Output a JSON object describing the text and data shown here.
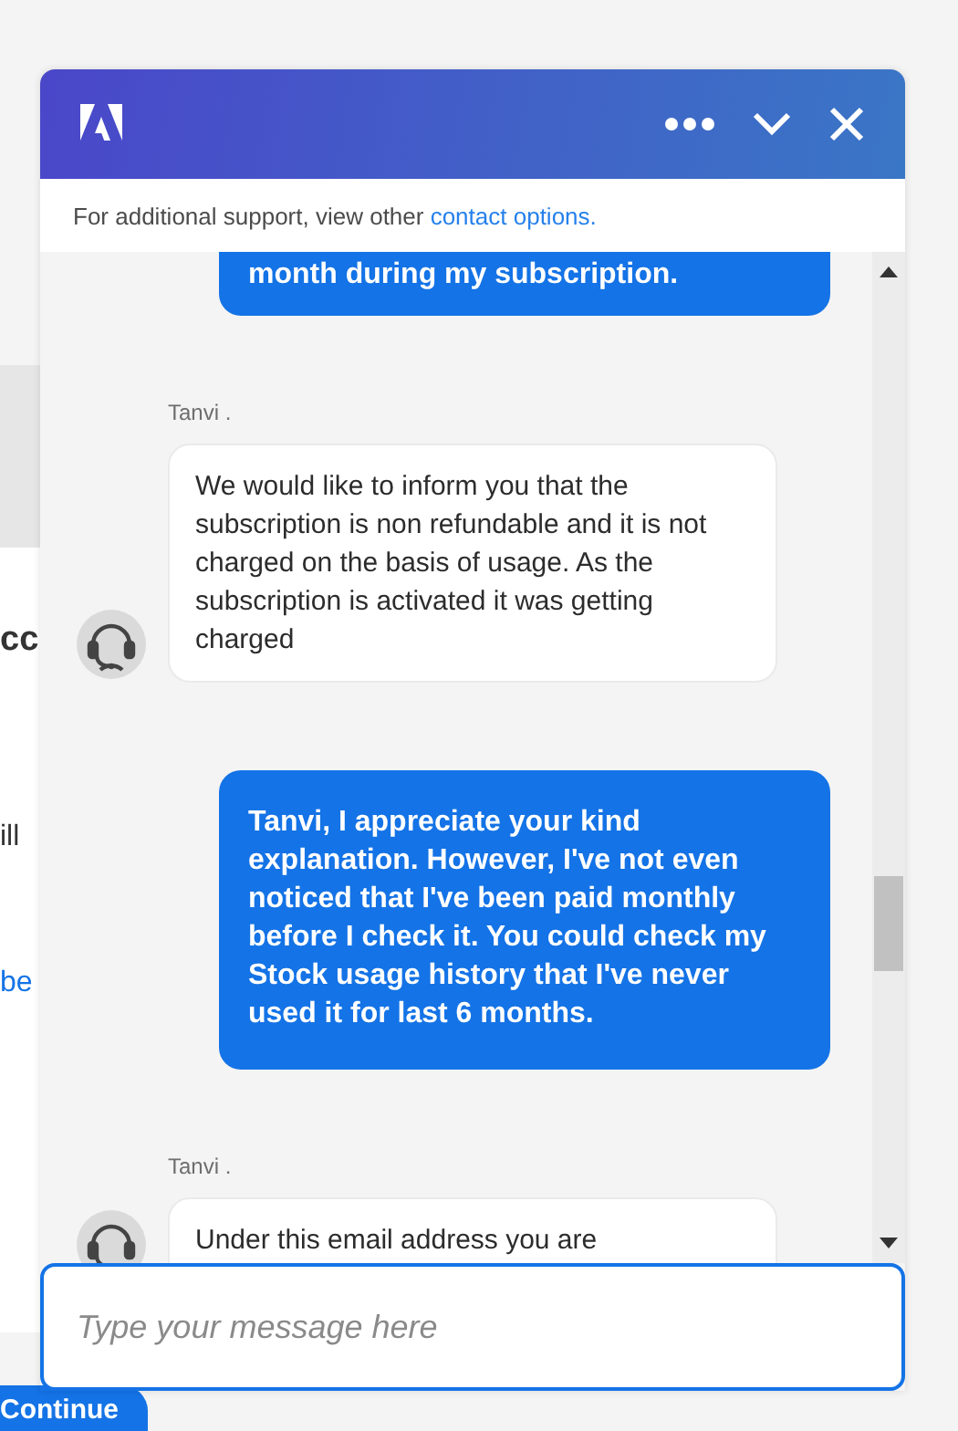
{
  "background_page": {
    "texts": [
      {
        "text": "cc",
        "kind": "heading"
      },
      {
        "text": "ill",
        "kind": "body"
      },
      {
        "text": "be",
        "kind": "link"
      }
    ],
    "continue_button": "Continue"
  },
  "chat": {
    "support_note": {
      "text": "For additional support, view other ",
      "link": "contact options."
    },
    "messages": [
      {
        "kind": "user",
        "text": "month during my subscription."
      },
      {
        "kind": "agent",
        "sender": "Tanvi .",
        "text": "We would like to inform you that the subscription is non refundable and it is not charged on the basis of usage. As the subscription is activated it was getting charged"
      },
      {
        "kind": "user",
        "text": "Tanvi, I appreciate your kind explanation. However, I've not even noticed that I've been paid monthly before I check it. You could check my Stock usage history that I've never used it for last 6 months."
      },
      {
        "kind": "agent",
        "sender": "Tanvi .",
        "text": "Under this email address you are"
      }
    ],
    "input": {
      "placeholder": "Type your message here"
    }
  }
}
